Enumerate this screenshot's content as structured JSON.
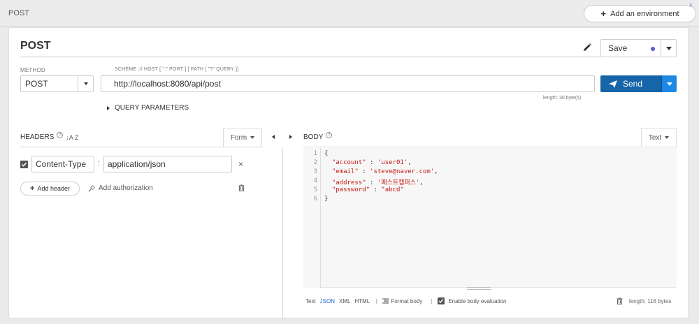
{
  "tab": {
    "title": "POST"
  },
  "top": {
    "add_env_label": "Add an environment",
    "corner_glyph": "x"
  },
  "request": {
    "title": "POST",
    "save_label": "Save",
    "method_label": "METHOD",
    "scheme_label": "SCHEME :// HOST [ \":\" PORT ] [ PATH [ \"?\" QUERY ]]",
    "method": "POST",
    "url": "http://localhost:8080/api/post",
    "send_label": "Send",
    "length_url": "length: 30 byte(s)",
    "query_params_label": "QUERY PARAMETERS"
  },
  "headers": {
    "label": "HEADERS",
    "mode": "Form",
    "items": [
      {
        "name": "Content-Type",
        "value": "application/json",
        "enabled": true
      }
    ],
    "add_header_label": "Add header",
    "add_auth_label": "Add authorization"
  },
  "body": {
    "label": "BODY",
    "mode": "Text",
    "lines": [
      "1",
      "2",
      "3",
      "4",
      "5",
      "6"
    ],
    "json": {
      "open": "{",
      "k1": "\"account\"",
      "v1": "'user01'",
      "k2": "\"email\"",
      "v2": "'steve@naver.com'",
      "k3": "\"address\"",
      "v3": "'패스트캠퍼스'",
      "k4": "\"password\"",
      "v4": "\"abcd\"",
      "close": "}"
    },
    "formats": [
      "Text",
      "JSON",
      "XML",
      "HTML"
    ],
    "active_format": "JSON",
    "format_body_label": "Format body",
    "enable_eval_label": "Enable body evaluation",
    "length": "length: 116 bytes"
  },
  "colors": {
    "send_primary": "#1565a8",
    "send_secondary": "#1e88e5",
    "save_dot": "#5b5bd6",
    "active_format": "#1e6fd9",
    "string": "#c41a16"
  }
}
